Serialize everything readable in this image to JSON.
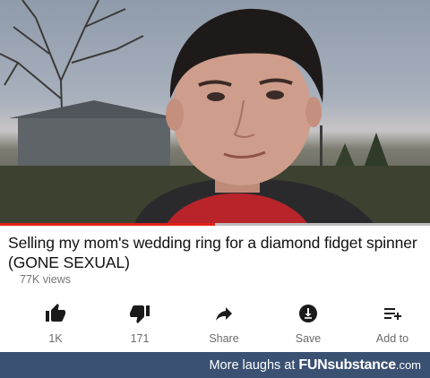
{
  "video": {
    "title": "Selling my mom's wedding ring for a diamond fidget spinner (GONE SEXUAL)",
    "views": "77K views",
    "progress": 0.5
  },
  "actions": [
    {
      "label": "1K",
      "icon": "thumbs-up-icon"
    },
    {
      "label": "171",
      "icon": "thumbs-down-icon"
    },
    {
      "label": "Share",
      "icon": "share-arrow-icon"
    },
    {
      "label": "Save",
      "icon": "save-download-icon"
    },
    {
      "label": "Add to",
      "icon": "add-to-playlist-icon"
    }
  ],
  "watermark": {
    "lead": "More laughs at",
    "brand_bold": "FUN",
    "brand_rest": "substance",
    "brand_tld": ".com"
  },
  "colors": {
    "progress_red": "#e62117",
    "icon_dark": "#1a1a1a",
    "label_gray": "#6b6b6b",
    "footer_bg": "#3a5172"
  }
}
